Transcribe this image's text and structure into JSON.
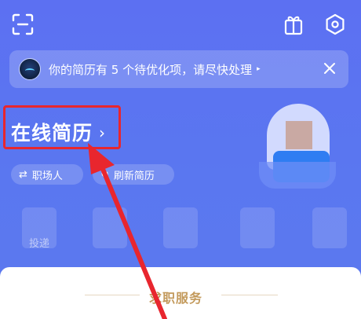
{
  "notice": {
    "text": "你的简历有 5 个待优化项，请尽快处理",
    "caret": "▸"
  },
  "resume": {
    "title": "在线简历",
    "arrow": "›"
  },
  "pills": [
    {
      "icon": "⇄",
      "label": "职场人"
    },
    {
      "icon": "↻",
      "label": "刷新简历"
    }
  ],
  "stats": [
    {
      "label": "投递"
    },
    {
      "label": ""
    },
    {
      "label": ""
    },
    {
      "label": ""
    },
    {
      "label": ""
    }
  ],
  "card": {
    "section_title": "求职服务"
  },
  "colors": {
    "header_blue": "#5a74f0",
    "highlight_red": "#e8262e",
    "gold": "#c39a5c"
  }
}
